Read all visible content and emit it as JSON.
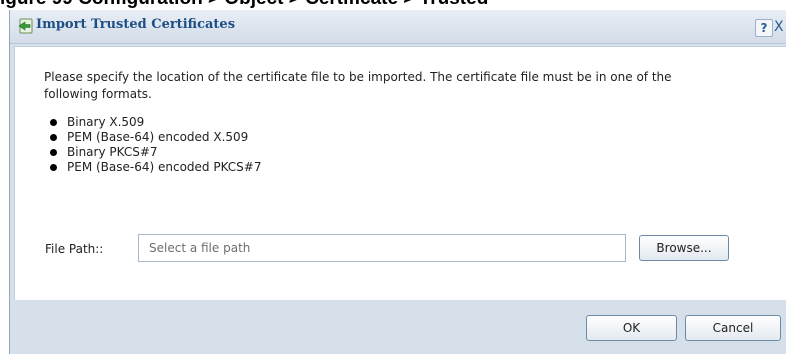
{
  "page_caption": "igure 99   Configuration > Object > Certificate > Trusted",
  "dialog": {
    "title": "Import Trusted Certificates",
    "help_label": "?",
    "close_label": "X",
    "intro": "Please specify the location of the certificate file to be imported. The certificate file must be in one of the following formats.",
    "formats": [
      "Binary X.509",
      "PEM (Base-64) encoded X.509",
      "Binary PKCS#7",
      "PEM (Base-64) encoded PKCS#7"
    ],
    "file_path": {
      "label": "File Path::",
      "value": "",
      "placeholder": "Select a file path"
    },
    "browse_label": "Browse...",
    "ok_label": "OK",
    "cancel_label": "Cancel"
  },
  "colors": {
    "title_text": "#1c4f86",
    "dialog_background": "#d6e0eb",
    "button_border": "#6f8aa8"
  },
  "icons": {
    "title_icon": "import-certificate-icon",
    "bullet": "bullet-icon"
  }
}
